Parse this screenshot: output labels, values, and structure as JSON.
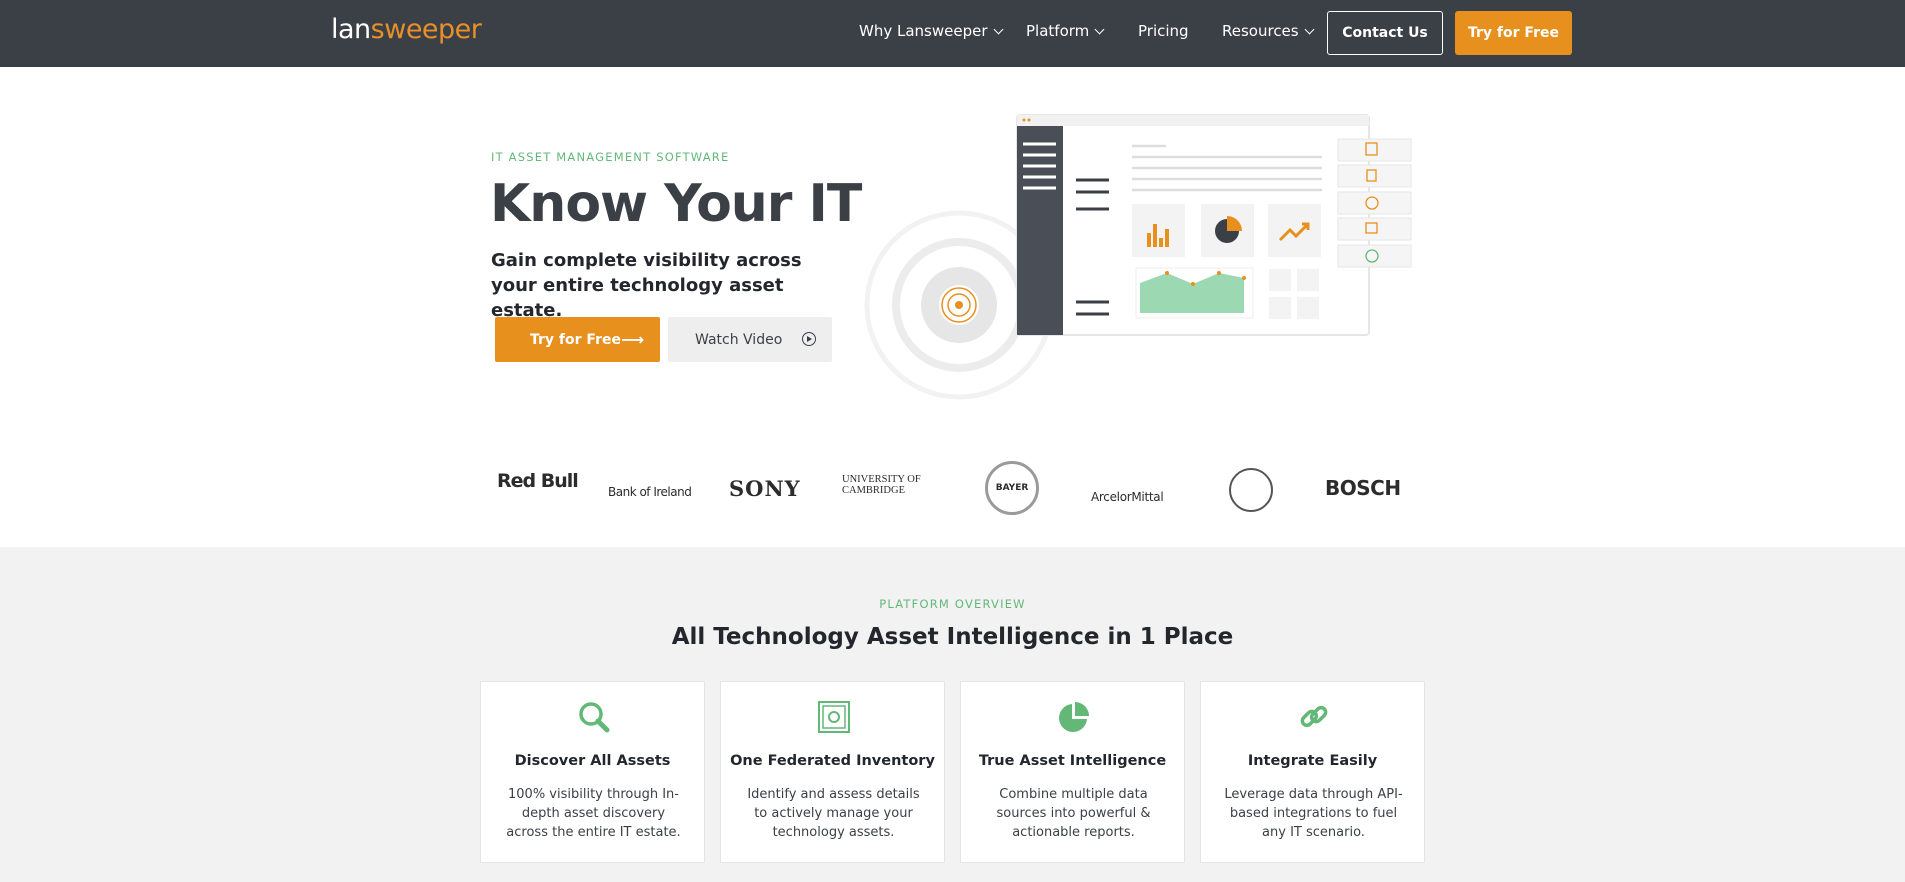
{
  "nav": {
    "logo_part1": "lan",
    "logo_part2": "sweeper",
    "items": [
      {
        "label": "Why Lansweeper",
        "has_dropdown": true
      },
      {
        "label": "Platform",
        "has_dropdown": true
      },
      {
        "label": "Pricing",
        "has_dropdown": false
      },
      {
        "label": "Resources",
        "has_dropdown": true
      }
    ],
    "contact_label": "Contact Us",
    "try_label": "Try for Free"
  },
  "hero": {
    "eyebrow": "IT ASSET MANAGEMENT SOFTWARE",
    "title": "Know Your IT",
    "subtitle": "Gain complete visibility across your entire technology asset estate.",
    "try_label": "Try for Free",
    "watch_label": "Watch Video"
  },
  "logos": {
    "items": [
      {
        "name": "Red Bull"
      },
      {
        "name": "Bank of Ireland"
      },
      {
        "name": "SONY"
      },
      {
        "name": "UNIVERSITY OF CAMBRIDGE"
      },
      {
        "name": "BAYER"
      },
      {
        "name": "ArcelorMittal"
      },
      {
        "name": "city-seal"
      },
      {
        "name": "BOSCH"
      }
    ]
  },
  "platform": {
    "eyebrow": "PLATFORM OVERVIEW",
    "title": "All Technology Asset Intelligence in 1 Place",
    "cards": [
      {
        "title": "Discover All Assets",
        "desc": "100% visibility through In-depth asset discovery across the entire IT estate.",
        "icon": "discover-icon"
      },
      {
        "title": "One Federated Inventory",
        "desc": "Identify and assess details to actively manage your technology assets.",
        "icon": "inventory-safe-icon"
      },
      {
        "title": "True Asset Intelligence",
        "desc": "Combine multiple data sources into powerful & actionable reports.",
        "icon": "pie-chart-icon"
      },
      {
        "title": "Integrate Easily",
        "desc": "Leverage data through API-based integrations to fuel any IT scenario.",
        "icon": "link-icon"
      }
    ]
  },
  "colors": {
    "nav_bg": "#3b3f46",
    "accent_orange": "#e8901e",
    "accent_green": "#63b878"
  }
}
